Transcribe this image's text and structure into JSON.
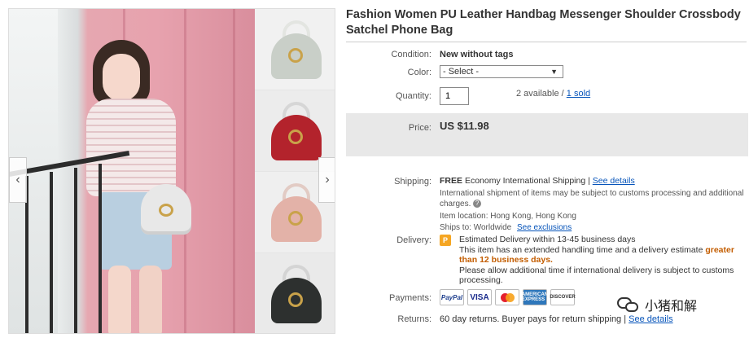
{
  "listing": {
    "title": "Fashion Women PU Leather Handbag Messenger Shoulder Crossbody Satchel Phone Bag"
  },
  "gallery": {
    "prev_arrow": "‹",
    "next_arrow": "›",
    "thumbnails": [
      {
        "color": "#c9cfc8",
        "handle": "#e9ebe7"
      },
      {
        "color": "#b3232c",
        "handle": "#dcdcdc"
      },
      {
        "color": "#e3b2a8",
        "handle": "#e7d2cc"
      },
      {
        "color": "#2d302f",
        "handle": "#d9d9d9"
      }
    ]
  },
  "fields": {
    "condition_label": "Condition:",
    "condition_value": "New without tags",
    "color_label": "Color:",
    "color_select": "- Select -",
    "quantity_label": "Quantity:",
    "quantity_value": "1",
    "available": "2 available /",
    "sold": "1 sold",
    "price_label": "Price:",
    "price_value": "US $11.98"
  },
  "shipping": {
    "label": "Shipping:",
    "free": "FREE",
    "method": "Economy International Shipping |",
    "see_details": "See details",
    "customs_note": "International shipment of items may be subject to customs processing and additional charges.",
    "location_label": "Item location:",
    "location": "Hong Kong, Hong Kong",
    "ships_to_label": "Ships to:",
    "ships_to": "Worldwide",
    "see_exclusions": "See exclusions"
  },
  "delivery": {
    "label": "Delivery:",
    "icon_letter": "P",
    "estimate": "Estimated Delivery within 13-45 business days",
    "extended_prefix": "This item has an extended handling time and a delivery estimate",
    "extended_warn": "greater than 12 business days.",
    "allow_note": "Please allow additional time if international delivery is subject to customs processing."
  },
  "payments": {
    "label": "Payments:",
    "cards": [
      "PayPal",
      "VISA",
      "",
      "AMERICAN EXPRESS",
      "DISCOVER"
    ]
  },
  "returns": {
    "label": "Returns:",
    "text": "60 day returns. Buyer pays for return shipping |",
    "see_details": "See details"
  },
  "watermark": {
    "text": "小猪和解"
  }
}
